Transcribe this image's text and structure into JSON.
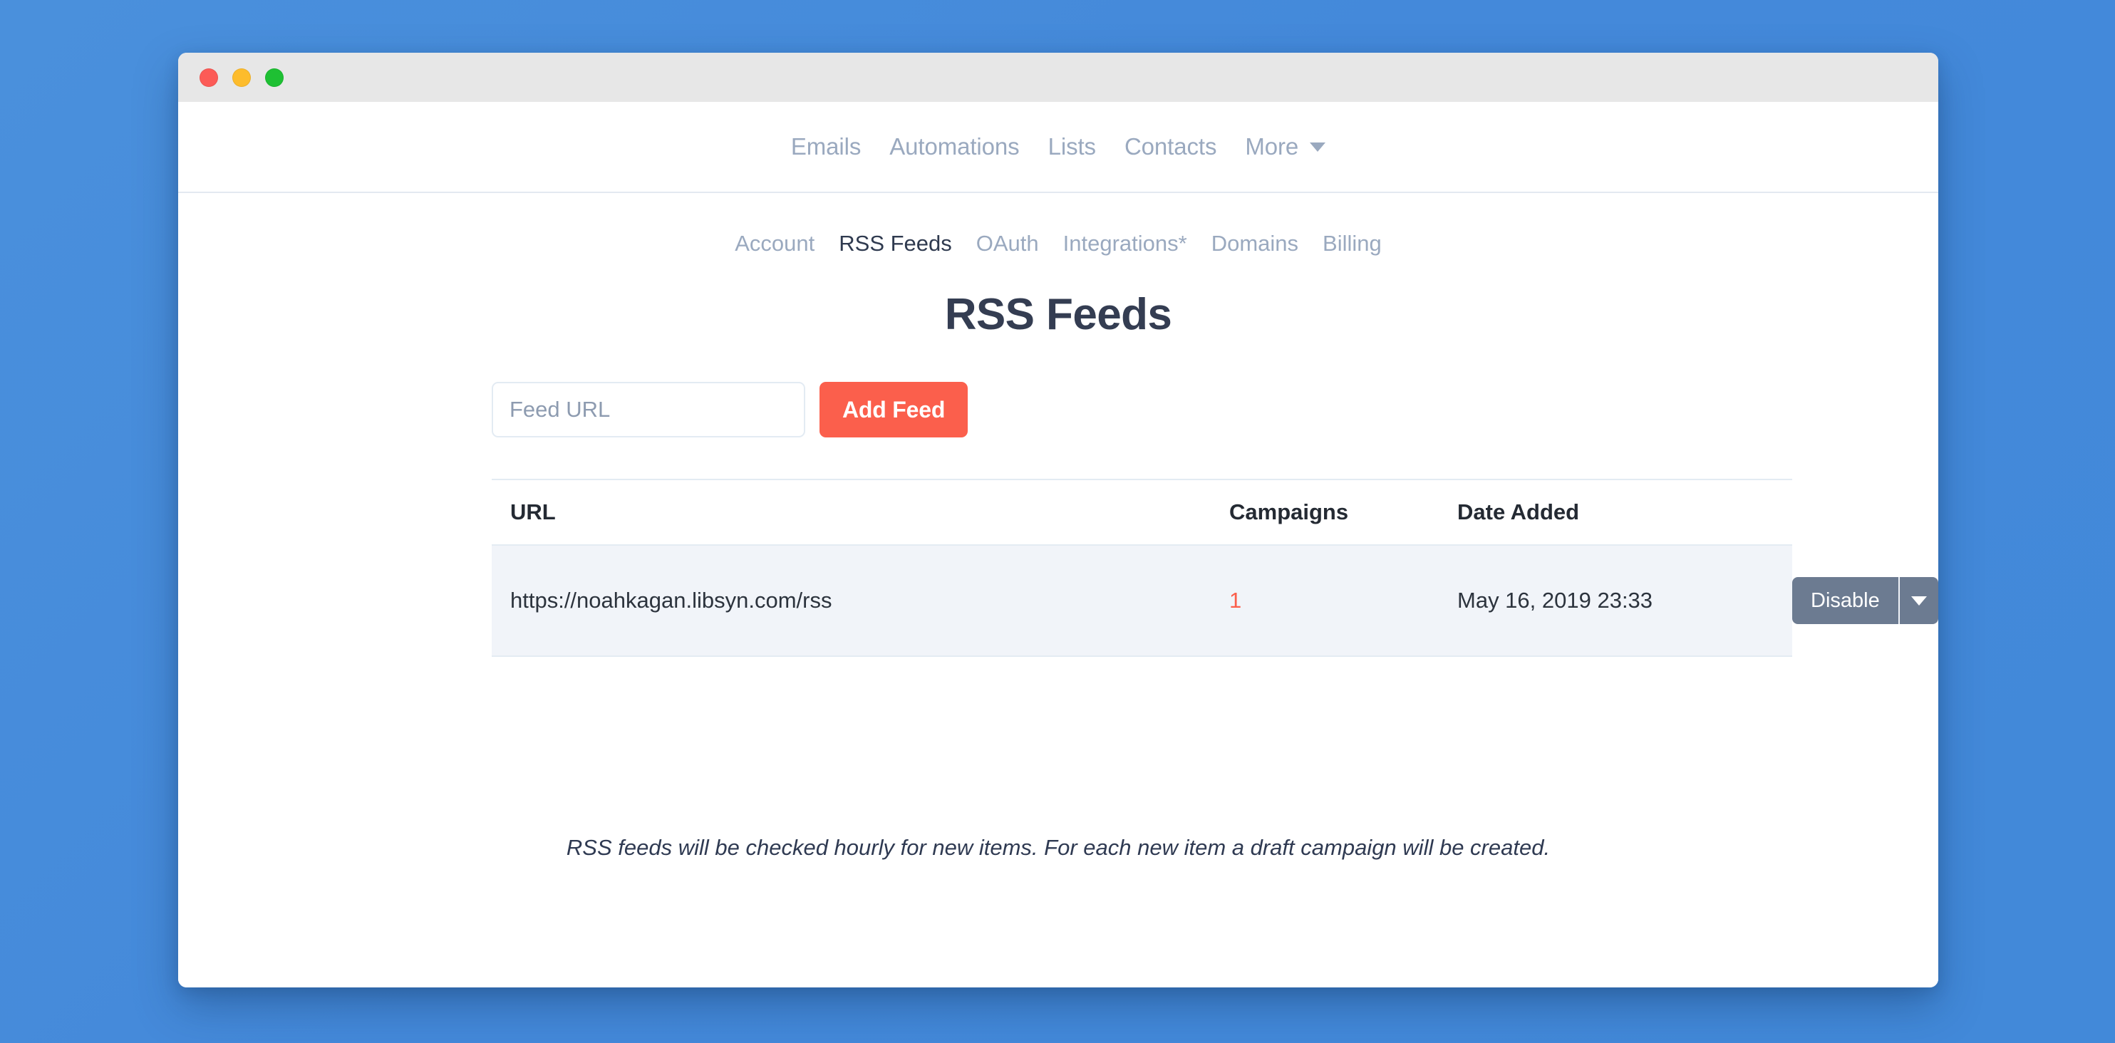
{
  "window": {
    "traffic_lights": [
      "close-button",
      "minimize-button",
      "maximize-button"
    ]
  },
  "top_nav": {
    "items": [
      {
        "label": "Emails",
        "active": false
      },
      {
        "label": "Automations",
        "active": false
      },
      {
        "label": "Lists",
        "active": false
      },
      {
        "label": "Contacts",
        "active": false
      },
      {
        "label": "More",
        "active": false,
        "caret": true
      }
    ]
  },
  "sub_nav": {
    "items": [
      {
        "label": "Account",
        "active": false
      },
      {
        "label": "RSS Feeds",
        "active": true
      },
      {
        "label": "OAuth",
        "active": false
      },
      {
        "label": "Integrations*",
        "active": false
      },
      {
        "label": "Domains",
        "active": false
      },
      {
        "label": "Billing",
        "active": false
      }
    ]
  },
  "page": {
    "title": "RSS Feeds"
  },
  "form": {
    "feed_url_value": "",
    "feed_url_placeholder": "Feed URL",
    "add_feed_label": "Add Feed"
  },
  "table": {
    "headers": {
      "url": "URL",
      "campaigns": "Campaigns",
      "date_added": "Date Added",
      "actions": ""
    },
    "rows": [
      {
        "url": "https://noahkagan.libsyn.com/rss",
        "campaigns": "1",
        "date_added": "May 16, 2019 23:33",
        "action_label": "Disable"
      }
    ]
  },
  "footer": {
    "note": "RSS feeds will be checked hourly for new items. For each new item a draft campaign will be created."
  },
  "colors": {
    "desktop_background": "#4a90dc",
    "accent": "#fb5f4c",
    "title_bar": "#e7e7e7",
    "row_background": "#f1f4f9",
    "border": "#e3ebf3",
    "muted_text": "#9aa9bf",
    "dark_text": "#343d52",
    "button_slate": "#6c7b91"
  }
}
